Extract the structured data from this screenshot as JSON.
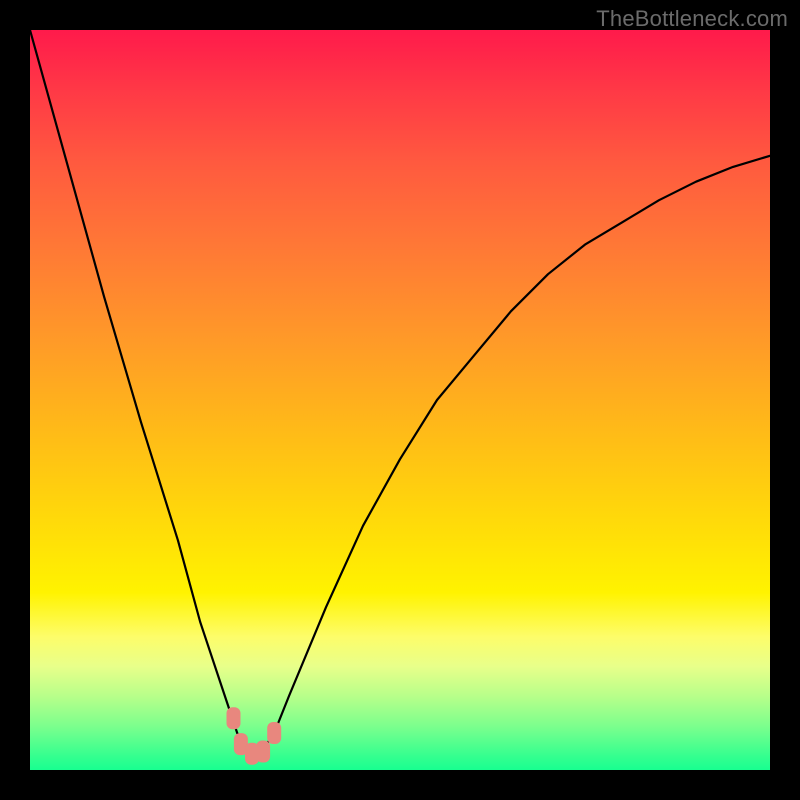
{
  "attribution": "TheBottleneck.com",
  "chart_data": {
    "type": "line",
    "title": "",
    "xlabel": "",
    "ylabel": "",
    "xlim": [
      0,
      100
    ],
    "ylim": [
      0,
      100
    ],
    "grid": false,
    "legend": false,
    "series": [
      {
        "name": "bottleneck-curve",
        "x": [
          0,
          5,
          10,
          15,
          20,
          23,
          26,
          28,
          29.5,
          31,
          33,
          35,
          40,
          45,
          50,
          55,
          60,
          65,
          70,
          75,
          80,
          85,
          90,
          95,
          100
        ],
        "y": [
          100,
          82,
          64,
          47,
          31,
          20,
          11,
          5,
          2,
          2,
          5,
          10,
          22,
          33,
          42,
          50,
          56,
          62,
          67,
          71,
          74,
          77,
          79.5,
          81.5,
          83
        ]
      }
    ],
    "highlight_points": [
      {
        "x": 27.5,
        "y": 7
      },
      {
        "x": 28.5,
        "y": 3.5
      },
      {
        "x": 30.0,
        "y": 2.2
      },
      {
        "x": 31.5,
        "y": 2.5
      },
      {
        "x": 33.0,
        "y": 5.0
      }
    ],
    "highlight_color": "#e8877e",
    "background_gradient": [
      "#ff1a4b",
      "#ff5a3f",
      "#ff9a28",
      "#ffd90a",
      "#fff300",
      "#b8ff8a",
      "#18ff90"
    ]
  }
}
